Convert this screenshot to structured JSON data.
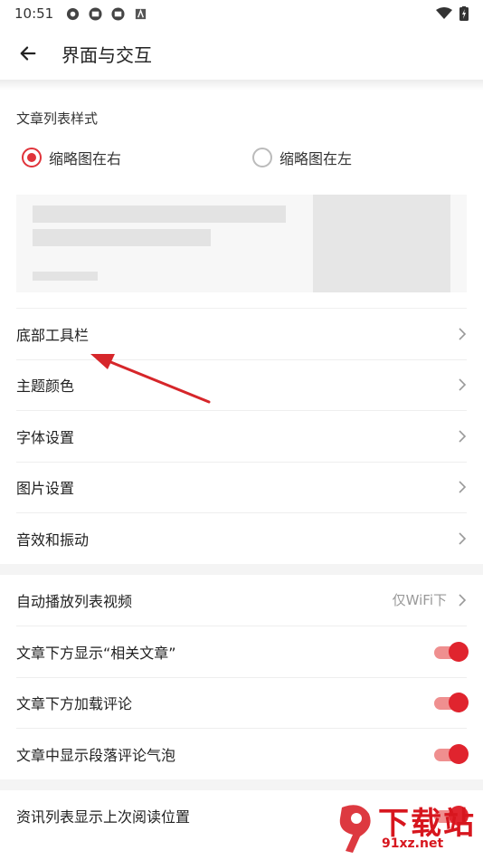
{
  "status_bar": {
    "time": "10:51"
  },
  "app_bar": {
    "title": "界面与交互"
  },
  "article_style": {
    "title": "文章列表样式",
    "options": [
      {
        "label": "缩略图在右",
        "selected": true
      },
      {
        "label": "缩略图在左",
        "selected": false
      }
    ]
  },
  "menu": [
    {
      "label": "底部工具栏"
    },
    {
      "label": "主题颜色"
    },
    {
      "label": "字体设置"
    },
    {
      "label": "图片设置"
    },
    {
      "label": "音效和振动"
    }
  ],
  "settings": {
    "autoplay": {
      "label": "自动播放列表视频",
      "value": "仅WiFi下"
    },
    "toggles": [
      {
        "label": "文章下方显示“相关文章”",
        "on": true
      },
      {
        "label": "文章下方加载评论",
        "on": true
      },
      {
        "label": "文章中显示段落评论气泡",
        "on": true
      }
    ]
  },
  "bottom": {
    "label": "资讯列表显示上次阅读位置",
    "on": true
  },
  "watermark": {
    "main": "下载站",
    "sub": "91xz.net"
  },
  "colors": {
    "accent": "#e0242e",
    "track": "#ef8f8f",
    "annotation": "#d6262a"
  }
}
